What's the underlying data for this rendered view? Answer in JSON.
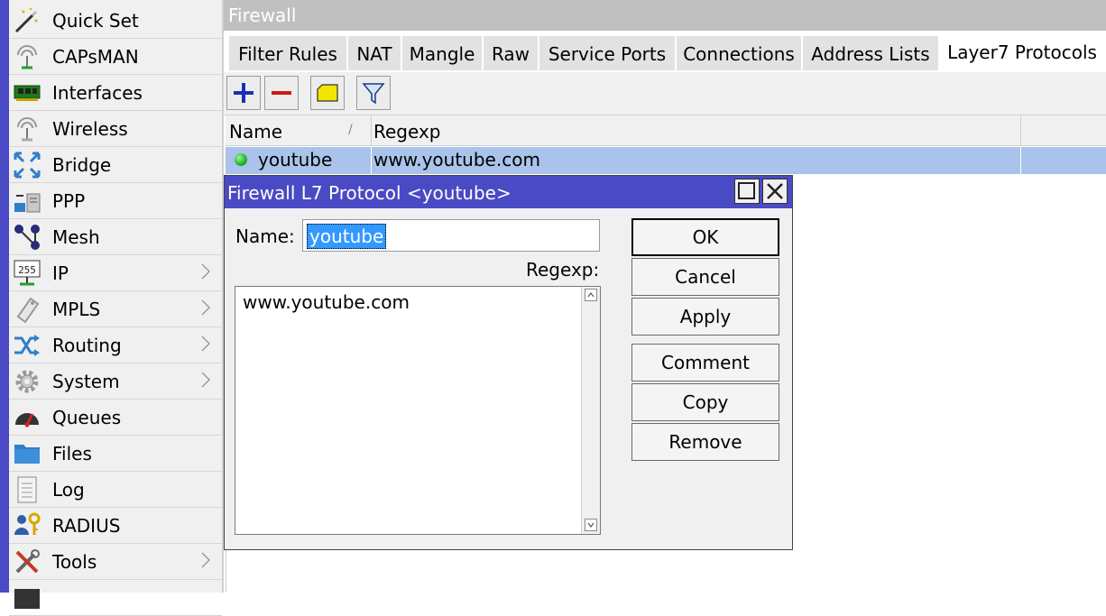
{
  "sidebar": {
    "items": [
      {
        "label": "Quick Set",
        "icon": "magic-wand-icon",
        "submenu": false
      },
      {
        "label": "CAPsMAN",
        "icon": "antenna-icon",
        "submenu": false
      },
      {
        "label": "Interfaces",
        "icon": "network-card-icon",
        "submenu": false
      },
      {
        "label": "Wireless",
        "icon": "wireless-icon",
        "submenu": false
      },
      {
        "label": "Bridge",
        "icon": "bridge-icon",
        "submenu": false
      },
      {
        "label": "PPP",
        "icon": "ppp-icon",
        "submenu": false
      },
      {
        "label": "Mesh",
        "icon": "mesh-icon",
        "submenu": false
      },
      {
        "label": "IP",
        "icon": "ip-icon",
        "submenu": true
      },
      {
        "label": "MPLS",
        "icon": "mpls-icon",
        "submenu": true
      },
      {
        "label": "Routing",
        "icon": "routing-icon",
        "submenu": true
      },
      {
        "label": "System",
        "icon": "gear-icon",
        "submenu": true
      },
      {
        "label": "Queues",
        "icon": "gauge-icon",
        "submenu": false
      },
      {
        "label": "Files",
        "icon": "folder-icon",
        "submenu": false
      },
      {
        "label": "Log",
        "icon": "log-icon",
        "submenu": false
      },
      {
        "label": "RADIUS",
        "icon": "radius-icon",
        "submenu": false
      },
      {
        "label": "Tools",
        "icon": "tools-icon",
        "submenu": true
      }
    ]
  },
  "firewall": {
    "title": "Firewall",
    "tabs": [
      {
        "label": "Filter Rules"
      },
      {
        "label": "NAT"
      },
      {
        "label": "Mangle"
      },
      {
        "label": "Raw"
      },
      {
        "label": "Service Ports"
      },
      {
        "label": "Connections"
      },
      {
        "label": "Address Lists"
      },
      {
        "label": "Layer7 Protocols",
        "active": true
      }
    ],
    "toolbar": [
      "add-icon",
      "remove-icon",
      "comment-icon",
      "filter-icon"
    ],
    "columns": {
      "name": "Name",
      "sort_glyph": "/",
      "regexp": "Regexp"
    },
    "rows": [
      {
        "name": "youtube",
        "regexp": "www.youtube.com",
        "status": "enabled"
      }
    ]
  },
  "dialog": {
    "title": "Firewall L7 Protocol <youtube>",
    "name_label": "Name:",
    "name_value": "youtube",
    "regexp_label": "Regexp:",
    "regexp_value": "www.youtube.com",
    "buttons": {
      "ok": "OK",
      "cancel": "Cancel",
      "apply": "Apply",
      "comment": "Comment",
      "copy": "Copy",
      "remove": "Remove"
    }
  },
  "colors": {
    "title_blue": "#4a4ac4",
    "selected_row": "#a9c3ea",
    "sidebar_bg": "#f0f0f0"
  }
}
